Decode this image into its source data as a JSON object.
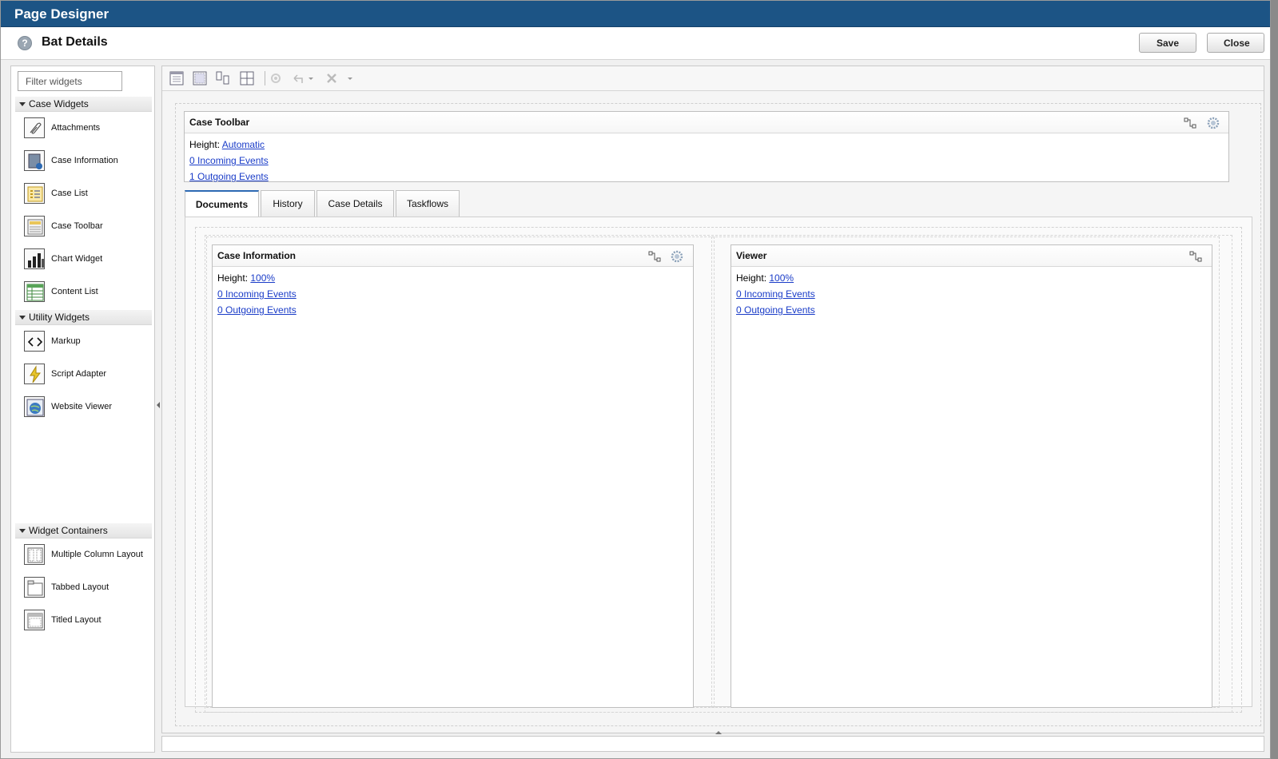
{
  "app": {
    "title": "Page Designer"
  },
  "header": {
    "page_title": "Bat Details",
    "save_label": "Save",
    "close_label": "Close",
    "help_glyph": "?"
  },
  "palette": {
    "filter_placeholder": "Filter widgets",
    "sections": [
      {
        "title": "Case Widgets",
        "items": [
          "Attachments",
          "Case Information",
          "Case List",
          "Case Toolbar",
          "Chart Widget",
          "Content List"
        ]
      },
      {
        "title": "Utility Widgets",
        "items": [
          "Markup",
          "Script Adapter",
          "Website Viewer"
        ]
      },
      {
        "title": "Widget Containers",
        "items": [
          "Multiple Column Layout",
          "Tabbed Layout",
          "Titled Layout"
        ]
      }
    ]
  },
  "toolbar": {
    "icons": [
      "layout-icon",
      "titled-layout-icon",
      "column-layout-icon",
      "grid-layout-icon",
      "settings-icon",
      "undo-icon",
      "delete-icon"
    ]
  },
  "case_toolbar": {
    "title": "Case Toolbar",
    "height_label": "Height:",
    "height_value": "Automatic",
    "incoming": "0 Incoming Events",
    "outgoing": "1 Outgoing Events"
  },
  "tabs": [
    {
      "label": "Documents",
      "active": true
    },
    {
      "label": "History",
      "active": false
    },
    {
      "label": "Case Details",
      "active": false
    },
    {
      "label": "Taskflows",
      "active": false
    }
  ],
  "case_information": {
    "title": "Case Information",
    "height_label": "Height:",
    "height_value": "100%",
    "incoming": "0 Incoming Events",
    "outgoing": "0 Outgoing Events"
  },
  "viewer": {
    "title": "Viewer",
    "height_label": "Height:",
    "height_value": "100%",
    "incoming": "0 Incoming Events",
    "outgoing": "0 Outgoing Events"
  },
  "colors": {
    "titlebar": "#1c5485",
    "link": "#1a3cc8",
    "active_tab": "#2d6ab3"
  }
}
